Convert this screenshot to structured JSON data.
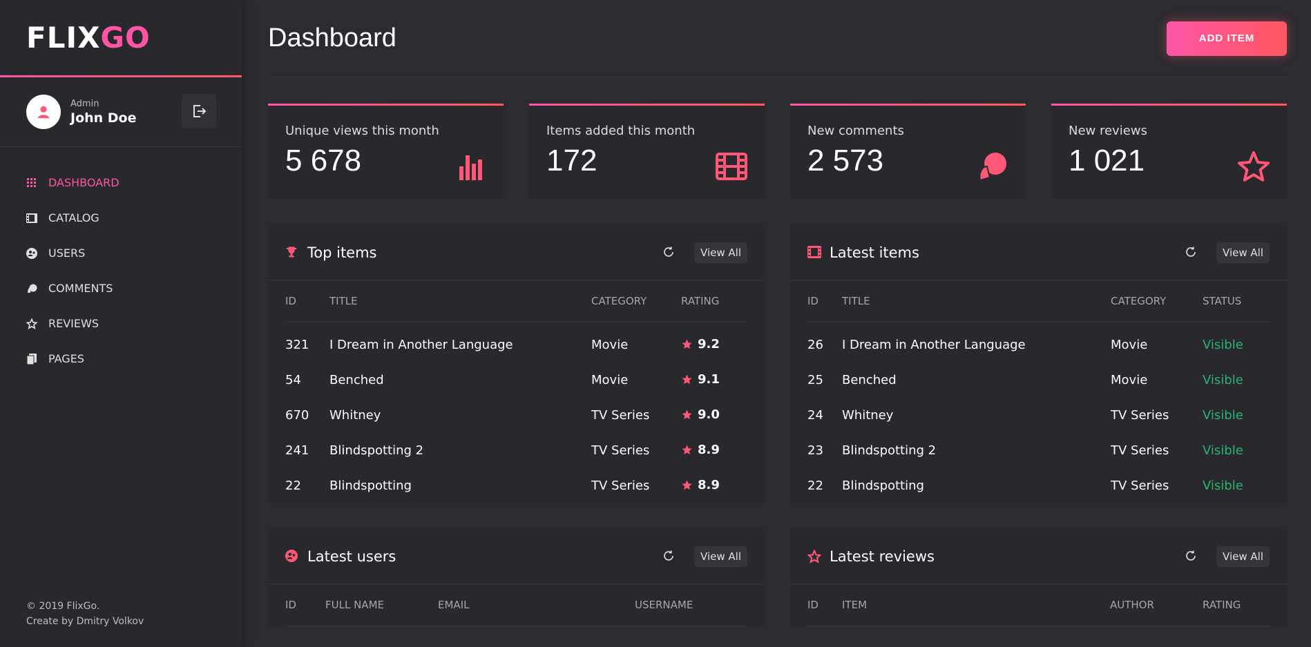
{
  "brand": {
    "part1": "FLIX",
    "part2": "GO"
  },
  "user": {
    "role": "Admin",
    "name": "John Doe"
  },
  "nav": [
    {
      "label": "DASHBOARD",
      "icon": "grid-icon",
      "active": true
    },
    {
      "label": "CATALOG",
      "icon": "film-icon"
    },
    {
      "label": "USERS",
      "icon": "users-icon"
    },
    {
      "label": "COMMENTS",
      "icon": "comments-icon"
    },
    {
      "label": "REVIEWS",
      "icon": "star-icon"
    },
    {
      "label": "PAGES",
      "icon": "pages-icon"
    }
  ],
  "footer": {
    "copyright": "© 2019 FlixGo.",
    "credit": "Create by Dmitry Volkov"
  },
  "header": {
    "title": "Dashboard",
    "add_button": "ADD ITEM"
  },
  "stats": [
    {
      "label": "Unique views this month",
      "value": "5 678",
      "icon": "bar-chart-icon"
    },
    {
      "label": "Items added this month",
      "value": "172",
      "icon": "film-icon"
    },
    {
      "label": "New comments",
      "value": "2 573",
      "icon": "comments-icon"
    },
    {
      "label": "New reviews",
      "value": "1 021",
      "icon": "star-icon"
    }
  ],
  "colors": {
    "accent": "#ff55a5",
    "accent2": "#ff5860",
    "visible": "#29b474",
    "bg": "#2b2b31",
    "panel": "#28282d"
  },
  "view_all_label": "View All",
  "top_items": {
    "title": "Top items",
    "columns": [
      "ID",
      "TITLE",
      "CATEGORY",
      "RATING"
    ],
    "rows": [
      {
        "id": "321",
        "title": "I Dream in Another Language",
        "category": "Movie",
        "rating": "9.2"
      },
      {
        "id": "54",
        "title": "Benched",
        "category": "Movie",
        "rating": "9.1"
      },
      {
        "id": "670",
        "title": "Whitney",
        "category": "TV Series",
        "rating": "9.0"
      },
      {
        "id": "241",
        "title": "Blindspotting 2",
        "category": "TV Series",
        "rating": "8.9"
      },
      {
        "id": "22",
        "title": "Blindspotting",
        "category": "TV Series",
        "rating": "8.9"
      }
    ]
  },
  "latest_items": {
    "title": "Latest items",
    "columns": [
      "ID",
      "TITLE",
      "CATEGORY",
      "STATUS"
    ],
    "rows": [
      {
        "id": "26",
        "title": "I Dream in Another Language",
        "category": "Movie",
        "status": "Visible"
      },
      {
        "id": "25",
        "title": "Benched",
        "category": "Movie",
        "status": "Visible"
      },
      {
        "id": "24",
        "title": "Whitney",
        "category": "TV Series",
        "status": "Visible"
      },
      {
        "id": "23",
        "title": "Blindspotting 2",
        "category": "TV Series",
        "status": "Visible"
      },
      {
        "id": "22",
        "title": "Blindspotting",
        "category": "TV Series",
        "status": "Visible"
      }
    ]
  },
  "latest_users": {
    "title": "Latest users",
    "columns": [
      "ID",
      "FULL NAME",
      "EMAIL",
      "USERNAME"
    ]
  },
  "latest_reviews": {
    "title": "Latest reviews",
    "columns": [
      "ID",
      "ITEM",
      "AUTHOR",
      "RATING"
    ]
  }
}
